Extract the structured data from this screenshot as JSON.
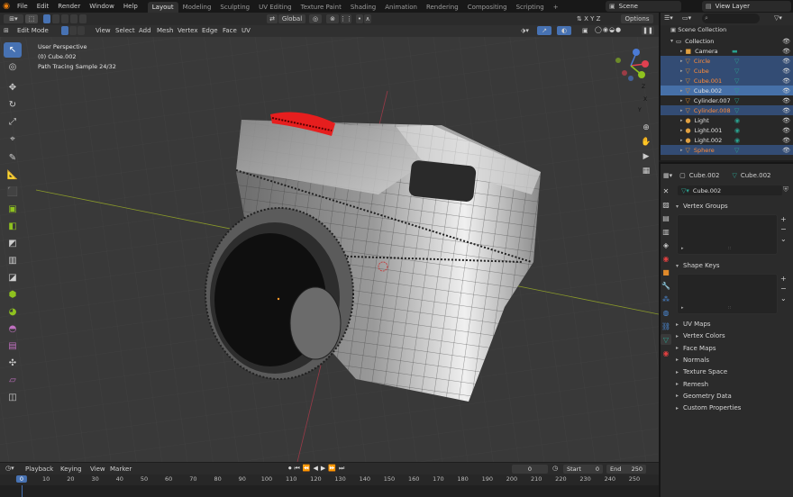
{
  "menubar": {
    "menus": [
      "File",
      "Edit",
      "Render",
      "Window",
      "Help"
    ],
    "workspaces": [
      "Layout",
      "Modeling",
      "Sculpting",
      "UV Editing",
      "Texture Paint",
      "Shading",
      "Animation",
      "Rendering",
      "Compositing",
      "Scripting"
    ],
    "active_workspace": "Layout",
    "add_tab": "+",
    "scene": "Scene",
    "view_layer": "View Layer"
  },
  "viewport_header": {
    "mode": "Edit Mode",
    "menus": [
      "View",
      "Select",
      "Add",
      "Mesh",
      "Vertex",
      "Edge",
      "Face",
      "UV"
    ],
    "orientation": "Global",
    "options": "Options"
  },
  "viewport_overlay": {
    "perspective": "User Perspective",
    "object": "(0) Cube.002",
    "render_status": "Path Tracing Sample 24/32"
  },
  "gizmo": {
    "x": "X",
    "y": "Y",
    "z": "Z"
  },
  "outliner": {
    "root": "Scene Collection",
    "collection": "Collection",
    "search_placeholder": "",
    "items": [
      {
        "name": "Camera",
        "selected": false,
        "orange": false,
        "icon": "camera-icon"
      },
      {
        "name": "Circle",
        "selected": true,
        "orange": true,
        "icon": "mesh-icon"
      },
      {
        "name": "Cube",
        "selected": true,
        "orange": true,
        "icon": "mesh-icon"
      },
      {
        "name": "Cube.001",
        "selected": true,
        "orange": true,
        "icon": "mesh-icon"
      },
      {
        "name": "Cube.002",
        "selected": true,
        "active": true,
        "orange": false,
        "icon": "mesh-icon"
      },
      {
        "name": "Cylinder.007",
        "selected": false,
        "orange": false,
        "icon": "mesh-icon"
      },
      {
        "name": "Cylinder.008",
        "selected": true,
        "orange": true,
        "icon": "mesh-icon"
      },
      {
        "name": "Light",
        "selected": false,
        "orange": false,
        "icon": "light-icon"
      },
      {
        "name": "Light.001",
        "selected": false,
        "orange": false,
        "icon": "light-icon"
      },
      {
        "name": "Light.002",
        "selected": false,
        "orange": false,
        "icon": "light-icon"
      },
      {
        "name": "Sphere",
        "selected": true,
        "orange": true,
        "icon": "mesh-icon"
      }
    ]
  },
  "properties": {
    "object_name": "Cube.002",
    "mesh_name": "Cube.002",
    "datablock": "Cube.002",
    "panels_open": [
      "Vertex Groups",
      "Shape Keys"
    ],
    "panels_closed": [
      "UV Maps",
      "Vertex Colors",
      "Face Maps",
      "Normals",
      "Texture Space",
      "Remesh",
      "Geometry Data",
      "Custom Properties"
    ]
  },
  "timeline": {
    "menus": [
      "Playback",
      "Keying",
      "View",
      "Marker"
    ],
    "current_frame": "0",
    "start_label": "Start",
    "start": "0",
    "end_label": "End",
    "end": "250",
    "ticks": [
      "0",
      "10",
      "20",
      "30",
      "40",
      "50",
      "60",
      "70",
      "80",
      "90",
      "100",
      "110",
      "120",
      "130",
      "140",
      "150",
      "160",
      "170",
      "180",
      "190",
      "200",
      "210",
      "220",
      "230",
      "240",
      "250"
    ]
  },
  "colors": {
    "accent": "#4772b3",
    "selection": "#334c74",
    "orange_text": "#ff8c3a",
    "mesh_green": "#2aa18f",
    "header": "#2b2b2b"
  }
}
